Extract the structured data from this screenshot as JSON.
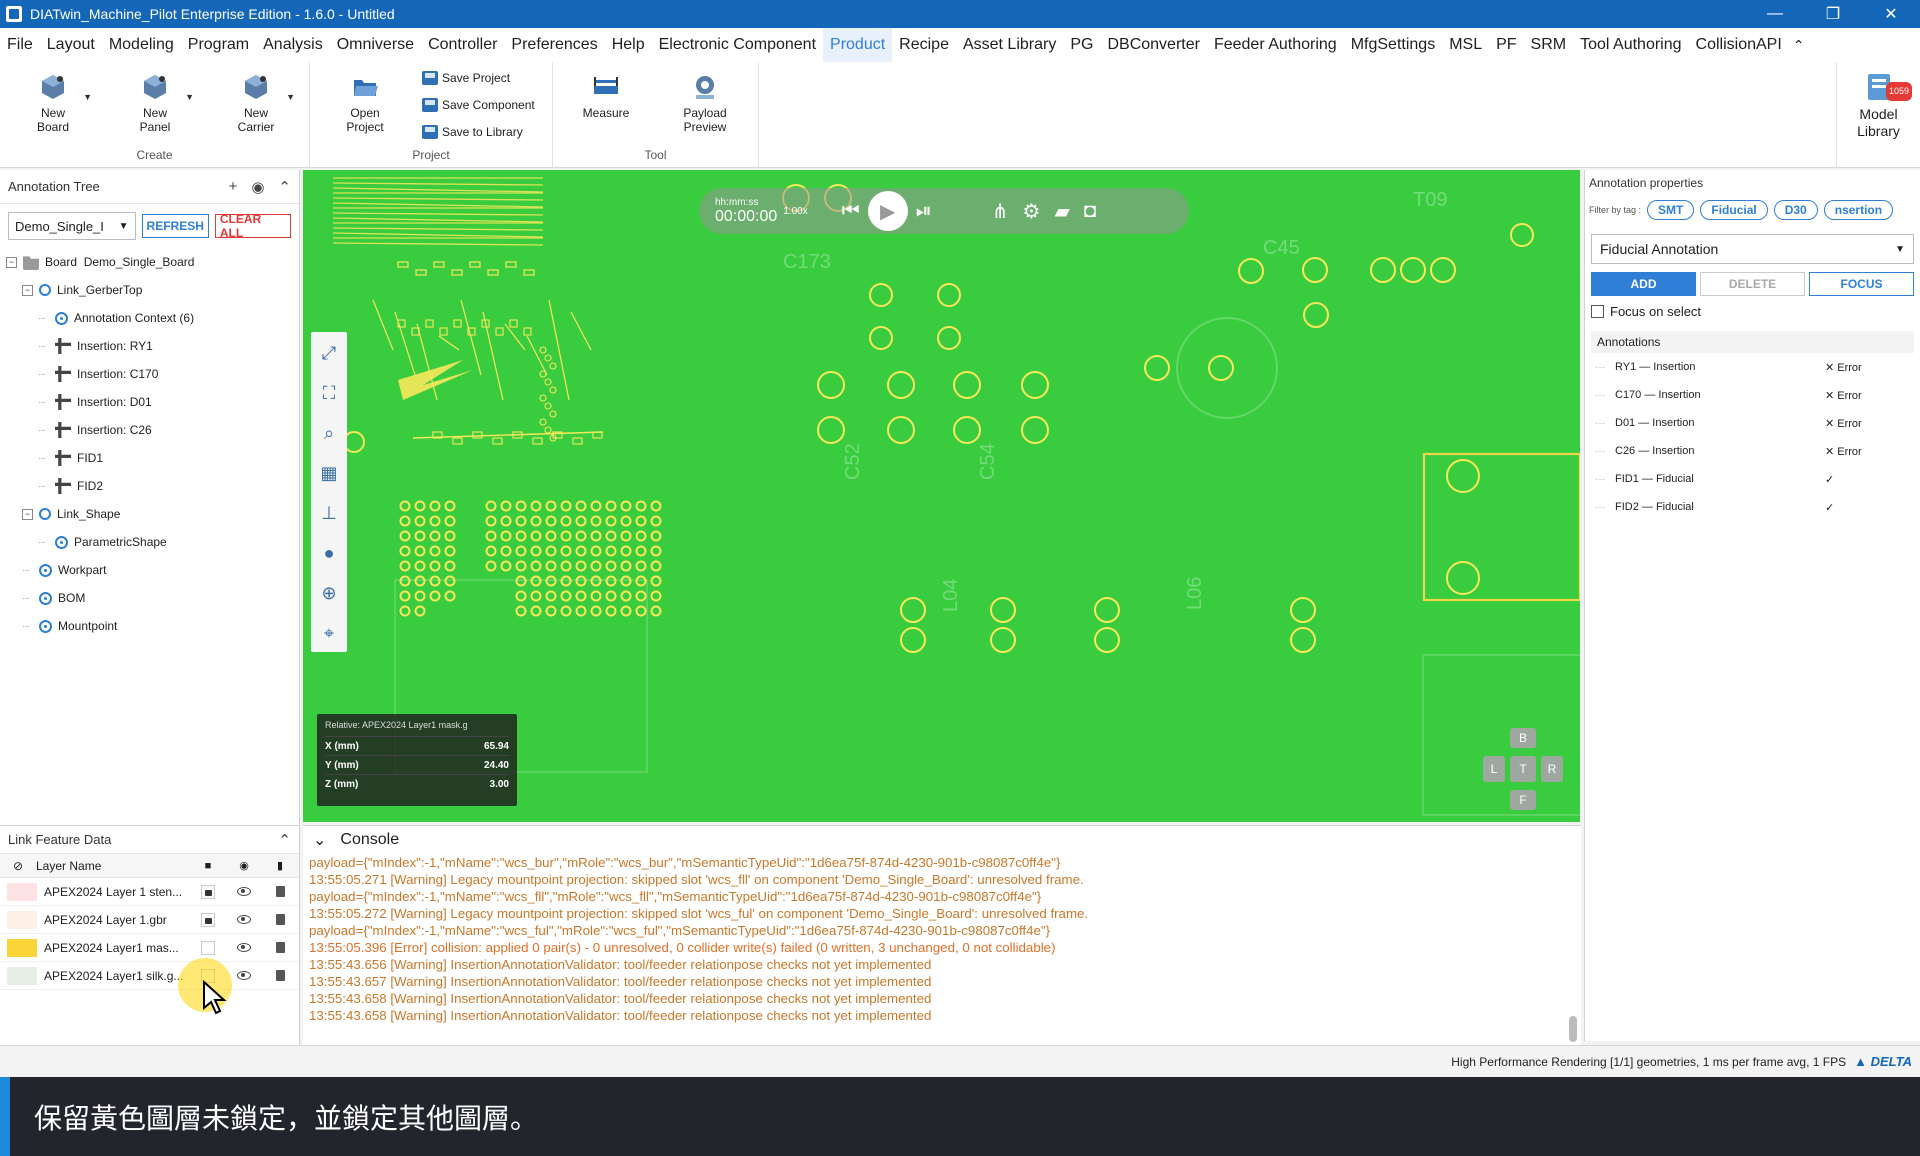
{
  "window": {
    "title": "DIATwin_Machine_Pilot Enterprise Edition - 1.6.0 - Untitled",
    "controls": [
      "—",
      "❐",
      "✕"
    ]
  },
  "menu": [
    "File",
    "Layout",
    "Modeling",
    "Program",
    "Analysis",
    "Omniverse",
    "Controller",
    "Preferences",
    "Help",
    "Electronic Component",
    "Product",
    "Recipe",
    "Asset Library",
    "PG",
    "DBConverter",
    "Feeder Authoring",
    "MfgSettings",
    "MSL",
    "PF",
    "SRM",
    "Tool Authoring",
    "CollisionAPI"
  ],
  "menu_active": "Product",
  "ribbon": {
    "create": {
      "label": "Create",
      "new_board": "New\nBoard",
      "new_panel": "New\nPanel",
      "new_carrier": "New\nCarrier"
    },
    "project": {
      "label": "Project",
      "open_project": "Open\nProject",
      "save_project": "Save Project",
      "save_component": "Save Component",
      "save_to_library": "Save to Library"
    },
    "tool": {
      "label": "Tool",
      "measure": "Measure",
      "payload_preview": "Payload\nPreview"
    },
    "model_library": {
      "label": "Model\nLibrary",
      "badge": "1059"
    }
  },
  "annotation_tree": {
    "title": "Annotation Tree",
    "board_select": "Demo_Single_I",
    "refresh": "REFRESH",
    "clear_all": "CLEAR ALL",
    "nodes": [
      {
        "label": "Board  Demo_Single_Board",
        "level": 0,
        "icon": "folder",
        "toggle": "−"
      },
      {
        "label": "Link_GerberTop",
        "level": 1,
        "icon": "link",
        "toggle": "−"
      },
      {
        "label": "Annotation Context (6)",
        "level": 2,
        "icon": "ctx",
        "toggle": ""
      },
      {
        "label": "Insertion: RY1",
        "level": 2,
        "icon": "ins",
        "toggle": ""
      },
      {
        "label": "Insertion: C170",
        "level": 2,
        "icon": "ins",
        "toggle": ""
      },
      {
        "label": "Insertion: D01",
        "level": 2,
        "icon": "ins",
        "toggle": ""
      },
      {
        "label": "Insertion: C26",
        "level": 2,
        "icon": "ins",
        "toggle": ""
      },
      {
        "label": "FID1",
        "level": 2,
        "icon": "ins",
        "toggle": ""
      },
      {
        "label": "FID2",
        "level": 2,
        "icon": "ins",
        "toggle": ""
      },
      {
        "label": "Link_Shape",
        "level": 1,
        "icon": "link",
        "toggle": "−"
      },
      {
        "label": "ParametricShape",
        "level": 2,
        "icon": "ctx",
        "toggle": ""
      },
      {
        "label": "Workpart",
        "level": 1,
        "icon": "ctx",
        "toggle": ""
      },
      {
        "label": "BOM",
        "level": 1,
        "icon": "ctx",
        "toggle": ""
      },
      {
        "label": "Mountpoint",
        "level": 1,
        "icon": "ctx",
        "toggle": ""
      }
    ]
  },
  "link_feature_data": {
    "title": "Link Feature Data",
    "column": "Layer Name",
    "layers": [
      {
        "name": "APEX2024 Layer 1 sten...",
        "color": "#fde3e3",
        "locked": true
      },
      {
        "name": "APEX2024 Layer 1.gbr",
        "color": "#fdf0e6",
        "locked": true
      },
      {
        "name": "APEX2024 Layer1 mas...",
        "color": "#f9d53a",
        "locked": false
      },
      {
        "name": "APEX2024 Layer1 silk.g...",
        "color": "#e6eee6",
        "locked": false
      }
    ]
  },
  "viewport": {
    "time_label": "hh:mm:ss",
    "time": "00:00:00",
    "speed": "1.00x",
    "readout": {
      "relative": "Relative: APEX2024 Layer1 mask.g",
      "rows": [
        {
          "axis": "X (mm)",
          "value": "65.94"
        },
        {
          "axis": "Y (mm)",
          "value": "24.40"
        },
        {
          "axis": "Z (mm)",
          "value": "3.00"
        }
      ]
    },
    "silk_labels": [
      "C173",
      "C45",
      "T09",
      "C52",
      "C54",
      "L04",
      "L06"
    ],
    "nav_cube": {
      "top": "B",
      "left": "L",
      "center": "T",
      "right": "R",
      "bottom": "F"
    }
  },
  "annotation_properties": {
    "title": "Annotation properties",
    "filter_label": "Filter by tag :",
    "tags": [
      "SMT",
      "Fiducial",
      "D30",
      "nsertion"
    ],
    "type_select": "Fiducial Annotation",
    "add": "ADD",
    "delete": "DELETE",
    "focus": "FOCUS",
    "focus_on_select": "Focus on select",
    "annotations_title": "Annotations",
    "annotations": [
      {
        "name": "RY1 — Insertion",
        "status": "✕ Error"
      },
      {
        "name": "C170 — Insertion",
        "status": "✕ Error"
      },
      {
        "name": "D01 — Insertion",
        "status": "✕ Error"
      },
      {
        "name": "C26 — Insertion",
        "status": "✕ Error"
      },
      {
        "name": "FID1 — Fiducial",
        "status": "✓"
      },
      {
        "name": "FID2 — Fiducial",
        "status": "✓"
      }
    ]
  },
  "console": {
    "title": "Console",
    "lines": [
      {
        "text": "payload={\"mIndex\":-1,\"mName\":\"wcs_bur\",\"mRole\":\"wcs_bur\",\"mSemanticTypeUid\":\"1d6ea75f-874d-4230-901b-c98087c0ff4e\"}",
        "level": "warn"
      },
      {
        "text": "13:55:05.271 [Warning] Legacy mountpoint projection: skipped slot 'wcs_fll' on component 'Demo_Single_Board': unresolved frame.",
        "level": "warn"
      },
      {
        "text": "payload={\"mIndex\":-1,\"mName\":\"wcs_fll\",\"mRole\":\"wcs_fll\",\"mSemanticTypeUid\":\"1d6ea75f-874d-4230-901b-c98087c0ff4e\"}",
        "level": "warn"
      },
      {
        "text": "13:55:05.272 [Warning] Legacy mountpoint projection: skipped slot 'wcs_ful' on component 'Demo_Single_Board': unresolved frame.",
        "level": "warn"
      },
      {
        "text": "payload={\"mIndex\":-1,\"mName\":\"wcs_ful\",\"mRole\":\"wcs_ful\",\"mSemanticTypeUid\":\"1d6ea75f-874d-4230-901b-c98087c0ff4e\"}",
        "level": "warn"
      },
      {
        "text": "13:55:05.396 [Error] collision: applied 0 pair(s) - 0 unresolved, 0 collider write(s) failed (0 written, 3 unchanged, 0 not collidable)",
        "level": "err"
      },
      {
        "text": "13:55:43.656 [Warning] InsertionAnnotationValidator: tool/feeder relationpose checks not yet implemented",
        "level": "warn"
      },
      {
        "text": "13:55:43.657 [Warning] InsertionAnnotationValidator: tool/feeder relationpose checks not yet implemented",
        "level": "warn"
      },
      {
        "text": "13:55:43.658 [Warning] InsertionAnnotationValidator: tool/feeder relationpose checks not yet implemented",
        "level": "warn"
      },
      {
        "text": "13:55:43.658 [Warning] InsertionAnnotationValidator: tool/feeder relationpose checks not yet implemented",
        "level": "warn"
      }
    ]
  },
  "status": {
    "text": "High Performance Rendering [1/1] geometries, 1 ms per frame avg, 1 FPS",
    "brand": "DELTA"
  },
  "caption": "保留黃色圖層未鎖定，並鎖定其他圖層。",
  "colors": {
    "titlebar": "#1466b8",
    "accent": "#2f7fd6",
    "board_green": "#39cc3f",
    "silk_yellow": "#f7e85a",
    "error_red": "#e53935"
  }
}
